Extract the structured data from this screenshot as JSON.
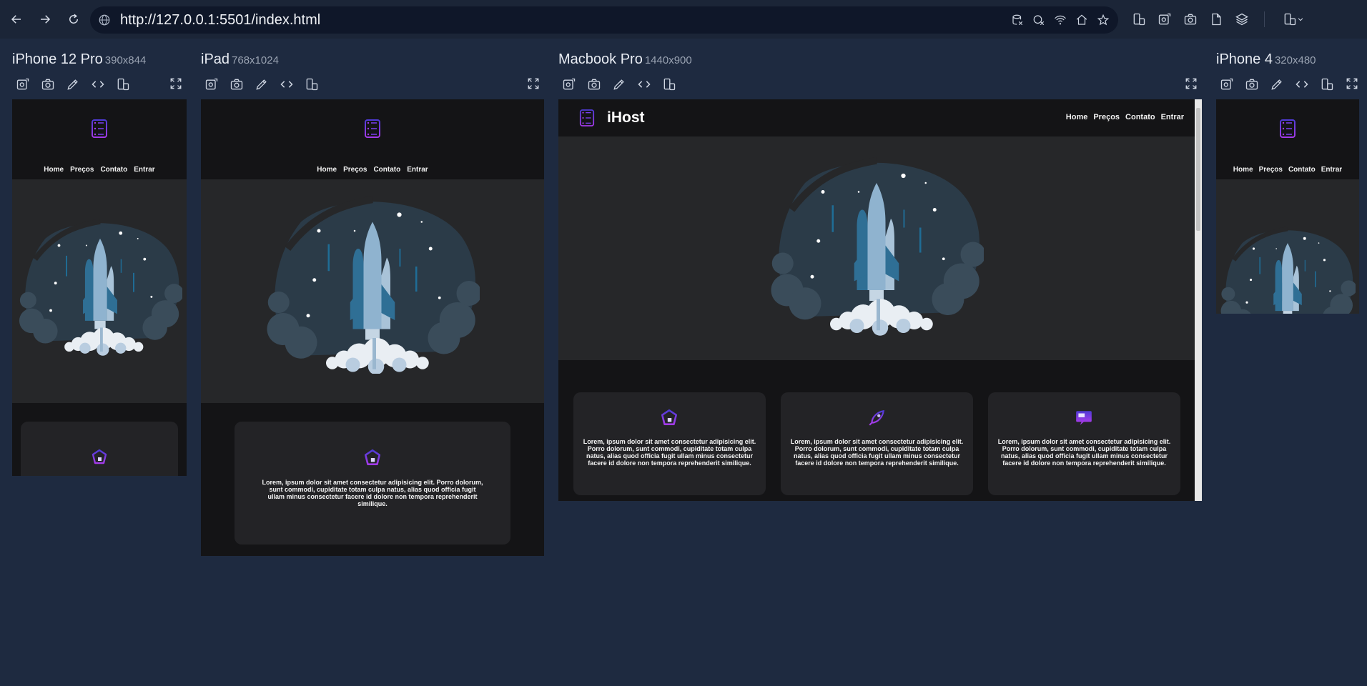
{
  "browser": {
    "url": "http://127.0.0.1:5501/index.html"
  },
  "site": {
    "logo_text": "iHost",
    "nav": [
      "Home",
      "Preços",
      "Contato",
      "Entrar"
    ],
    "card_text": "Lorem, ipsum dolor sit amet consectetur adipisicing elit. Porro dolorum, sunt commodi, cupiditate totam culpa natus, alias quod officia fugit ullam minus consectetur facere id dolore non tempora reprehenderit similique.",
    "card_icons": [
      "diamond-icon",
      "rocket-icon",
      "monitor-chat-icon"
    ]
  },
  "devices": [
    {
      "name": "iPhone 12 Pro",
      "size": "390x844"
    },
    {
      "name": "iPad",
      "size": "768x1024"
    },
    {
      "name": "Macbook Pro",
      "size": "1440x900"
    },
    {
      "name": "iPhone 4",
      "size": "320x480"
    }
  ],
  "colors": {
    "page_bg": "#1e2a40",
    "site_dark": "#141416",
    "hero_bg": "#262729",
    "accent_purple": "#7b3ff2",
    "rocket_blue": "#2f6f95"
  }
}
